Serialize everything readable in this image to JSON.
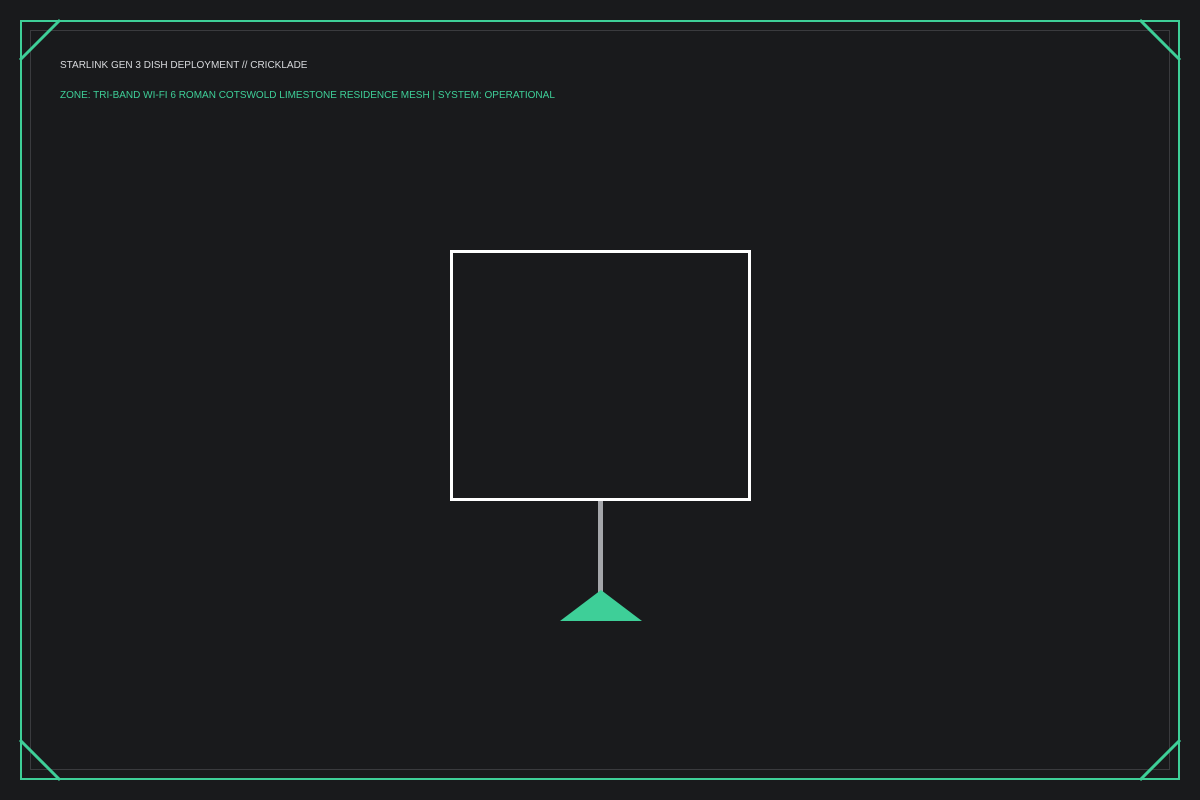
{
  "header": {
    "title": "STARLINK GEN 3 DISH DEPLOYMENT // CRICKLADE",
    "zone_status": "ZONE: TRI-BAND WI-FI 6 ROMAN COTSWOLD LIMESTONE RESIDENCE MESH | SYSTEM: OPERATIONAL"
  },
  "colors": {
    "background": "#191a1c",
    "accent": "#3ecf98",
    "dish_outline": "#ffffff",
    "mast": "#a4a6aa",
    "title_text": "#d7d9dc"
  },
  "icons": {
    "dish": "dish-panel-icon",
    "mast": "mount-pole-icon",
    "base": "tripod-base-icon"
  }
}
